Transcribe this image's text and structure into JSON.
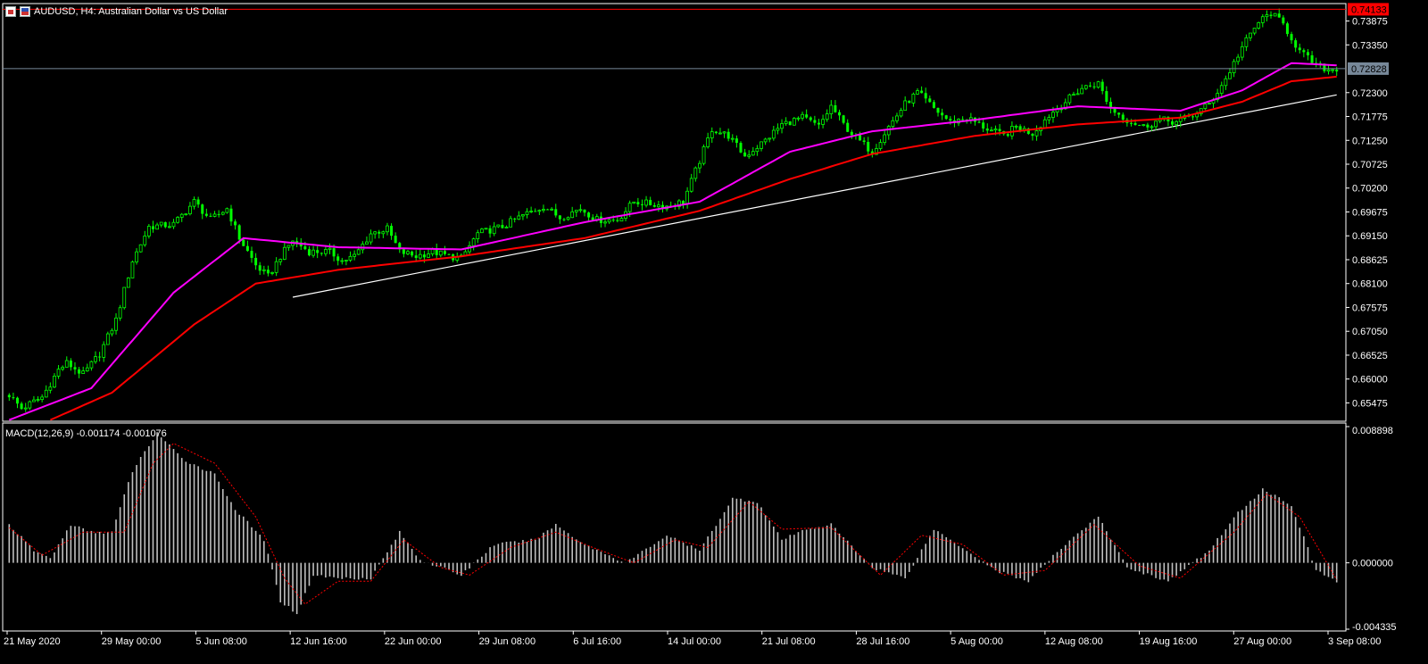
{
  "symbol_title": "AUDUSD, H4:  Australian Dollar vs US Dollar",
  "icons": [
    "chart-window-icon",
    "currency-flag-icon"
  ],
  "colors": {
    "background": "#000000",
    "bull_candle": "#00ff00",
    "ema_fast": "#ff00ff",
    "ema_slow": "#ff0000",
    "trendline": "#ffffff",
    "macd_hist": "#c0c0c0",
    "macd_signal": "#ff0000",
    "ask_line": "#ff0000",
    "bid_line": "#778899"
  },
  "price_axis": {
    "labels": [
      "0.73875",
      "0.73350",
      "0.72300",
      "0.71775",
      "0.71250",
      "0.70725",
      "0.70200",
      "0.69675",
      "0.69150",
      "0.68625",
      "0.68100",
      "0.67575",
      "0.67050",
      "0.66525",
      "0.66000",
      "0.65475"
    ],
    "ask_tag": "0.74133",
    "bid_tag": "0.72828"
  },
  "indicator": {
    "label": "MACD(12,26,9) -0.001174 -0.001076",
    "axis_labels": [
      "0.008898",
      "0.000000",
      "-0.004335"
    ]
  },
  "time_axis": [
    "21 May 2020",
    "29 May 00:00",
    "5 Jun 08:00",
    "12 Jun 16:00",
    "22 Jun 00:00",
    "29 Jun 08:00",
    "6 Jul 16:00",
    "14 Jul 00:00",
    "21 Jul 08:00",
    "28 Jul 16:00",
    "5 Aug 00:00",
    "12 Aug 08:00",
    "19 Aug 16:00",
    "27 Aug 00:00",
    "3 Sep 08:00"
  ],
  "chart_data": [
    {
      "type": "candlestick",
      "title": "AUDUSD, H4:  Australian Dollar vs US Dollar",
      "ylim": [
        0.6515,
        0.7418
      ],
      "ask": 0.74133,
      "bid": 0.72828,
      "close_keypoints": [
        {
          "t": 0,
          "v": 0.6565
        },
        {
          "t": 3,
          "v": 0.6535
        },
        {
          "t": 8,
          "v": 0.656
        },
        {
          "t": 12,
          "v": 0.662
        },
        {
          "t": 14,
          "v": 0.6635
        },
        {
          "t": 18,
          "v": 0.661
        },
        {
          "t": 22,
          "v": 0.6655
        },
        {
          "t": 26,
          "v": 0.673
        },
        {
          "t": 30,
          "v": 0.686
        },
        {
          "t": 34,
          "v": 0.6935
        },
        {
          "t": 40,
          "v": 0.694
        },
        {
          "t": 45,
          "v": 0.699
        },
        {
          "t": 49,
          "v": 0.695
        },
        {
          "t": 53,
          "v": 0.6975
        },
        {
          "t": 56,
          "v": 0.691
        },
        {
          "t": 60,
          "v": 0.685
        },
        {
          "t": 63,
          "v": 0.6825
        },
        {
          "t": 66,
          "v": 0.687
        },
        {
          "t": 69,
          "v": 0.6905
        },
        {
          "t": 73,
          "v": 0.688
        },
        {
          "t": 78,
          "v": 0.688
        },
        {
          "t": 81,
          "v": 0.686
        },
        {
          "t": 84,
          "v": 0.687
        },
        {
          "t": 88,
          "v": 0.692
        },
        {
          "t": 92,
          "v": 0.693
        },
        {
          "t": 95,
          "v": 0.688
        },
        {
          "t": 99,
          "v": 0.687
        },
        {
          "t": 103,
          "v": 0.688
        },
        {
          "t": 107,
          "v": 0.687
        },
        {
          "t": 110,
          "v": 0.6865
        },
        {
          "t": 114,
          "v": 0.692
        },
        {
          "t": 120,
          "v": 0.6935
        },
        {
          "t": 125,
          "v": 0.696
        },
        {
          "t": 130,
          "v": 0.698
        },
        {
          "t": 134,
          "v": 0.6955
        },
        {
          "t": 139,
          "v": 0.6975
        },
        {
          "t": 143,
          "v": 0.695
        },
        {
          "t": 148,
          "v": 0.695
        },
        {
          "t": 152,
          "v": 0.699
        },
        {
          "t": 156,
          "v": 0.6985
        },
        {
          "t": 160,
          "v": 0.698
        },
        {
          "t": 164,
          "v": 0.699
        },
        {
          "t": 168,
          "v": 0.708
        },
        {
          "t": 171,
          "v": 0.715
        },
        {
          "t": 175,
          "v": 0.7135
        },
        {
          "t": 179,
          "v": 0.709
        },
        {
          "t": 184,
          "v": 0.7125
        },
        {
          "t": 188,
          "v": 0.716
        },
        {
          "t": 193,
          "v": 0.7175
        },
        {
          "t": 197,
          "v": 0.7155
        },
        {
          "t": 200,
          "v": 0.72
        },
        {
          "t": 203,
          "v": 0.716
        },
        {
          "t": 206,
          "v": 0.713
        },
        {
          "t": 210,
          "v": 0.71
        },
        {
          "t": 214,
          "v": 0.7155
        },
        {
          "t": 218,
          "v": 0.7205
        },
        {
          "t": 221,
          "v": 0.723
        },
        {
          "t": 225,
          "v": 0.7195
        },
        {
          "t": 229,
          "v": 0.7165
        },
        {
          "t": 233,
          "v": 0.7175
        },
        {
          "t": 238,
          "v": 0.715
        },
        {
          "t": 242,
          "v": 0.7135
        },
        {
          "t": 245,
          "v": 0.7155
        },
        {
          "t": 249,
          "v": 0.714
        },
        {
          "t": 253,
          "v": 0.718
        },
        {
          "t": 257,
          "v": 0.721
        },
        {
          "t": 261,
          "v": 0.724
        },
        {
          "t": 265,
          "v": 0.725
        },
        {
          "t": 268,
          "v": 0.7195
        },
        {
          "t": 272,
          "v": 0.717
        },
        {
          "t": 276,
          "v": 0.7155
        },
        {
          "t": 280,
          "v": 0.717
        },
        {
          "t": 284,
          "v": 0.7165
        },
        {
          "t": 288,
          "v": 0.718
        },
        {
          "t": 292,
          "v": 0.7205
        },
        {
          "t": 296,
          "v": 0.726
        },
        {
          "t": 300,
          "v": 0.733
        },
        {
          "t": 304,
          "v": 0.7385
        },
        {
          "t": 307,
          "v": 0.7405
        },
        {
          "t": 310,
          "v": 0.738
        },
        {
          "t": 314,
          "v": 0.732
        },
        {
          "t": 318,
          "v": 0.729
        },
        {
          "t": 321,
          "v": 0.728
        },
        {
          "t": 323,
          "v": 0.7283
        }
      ],
      "ema_fast_keypoints": [
        {
          "t": 0,
          "v": 0.651
        },
        {
          "t": 20,
          "v": 0.658
        },
        {
          "t": 40,
          "v": 0.679
        },
        {
          "t": 57,
          "v": 0.691
        },
        {
          "t": 80,
          "v": 0.689
        },
        {
          "t": 110,
          "v": 0.6885
        },
        {
          "t": 140,
          "v": 0.6945
        },
        {
          "t": 168,
          "v": 0.699
        },
        {
          "t": 190,
          "v": 0.71
        },
        {
          "t": 210,
          "v": 0.7145
        },
        {
          "t": 235,
          "v": 0.717
        },
        {
          "t": 260,
          "v": 0.72
        },
        {
          "t": 285,
          "v": 0.719
        },
        {
          "t": 300,
          "v": 0.7235
        },
        {
          "t": 312,
          "v": 0.7295
        },
        {
          "t": 323,
          "v": 0.729
        }
      ],
      "ema_slow_keypoints": [
        {
          "t": 10,
          "v": 0.651
        },
        {
          "t": 25,
          "v": 0.657
        },
        {
          "t": 45,
          "v": 0.672
        },
        {
          "t": 60,
          "v": 0.681
        },
        {
          "t": 80,
          "v": 0.684
        },
        {
          "t": 110,
          "v": 0.687
        },
        {
          "t": 140,
          "v": 0.691
        },
        {
          "t": 168,
          "v": 0.697
        },
        {
          "t": 190,
          "v": 0.704
        },
        {
          "t": 210,
          "v": 0.7095
        },
        {
          "t": 235,
          "v": 0.7135
        },
        {
          "t": 260,
          "v": 0.716
        },
        {
          "t": 285,
          "v": 0.7175
        },
        {
          "t": 300,
          "v": 0.721
        },
        {
          "t": 312,
          "v": 0.7255
        },
        {
          "t": 323,
          "v": 0.7265
        }
      ],
      "trendline": {
        "from": {
          "t": 69,
          "v": 0.678
        },
        "to": {
          "t": 323,
          "v": 0.7225
        }
      }
    },
    {
      "type": "bar",
      "title": "MACD(12,26,9) -0.001174 -0.001076",
      "ylim": [
        -0.004335,
        0.008898
      ],
      "macd": -0.001174,
      "signal": -0.001076,
      "hist_keypoints": [
        {
          "t": 0,
          "v": 0.0025
        },
        {
          "t": 6,
          "v": 0.0008
        },
        {
          "t": 10,
          "v": 0.0003
        },
        {
          "t": 15,
          "v": 0.0025
        },
        {
          "t": 20,
          "v": 0.002
        },
        {
          "t": 25,
          "v": 0.002
        },
        {
          "t": 30,
          "v": 0.006
        },
        {
          "t": 36,
          "v": 0.0085
        },
        {
          "t": 42,
          "v": 0.0068
        },
        {
          "t": 50,
          "v": 0.0058
        },
        {
          "t": 55,
          "v": 0.0035
        },
        {
          "t": 62,
          "v": 0.0015
        },
        {
          "t": 66,
          "v": -0.0025
        },
        {
          "t": 70,
          "v": -0.0033
        },
        {
          "t": 74,
          "v": -0.0008
        },
        {
          "t": 80,
          "v": -0.001
        },
        {
          "t": 88,
          "v": -0.001
        },
        {
          "t": 95,
          "v": 0.002
        },
        {
          "t": 100,
          "v": 0.0002
        },
        {
          "t": 110,
          "v": -0.0008
        },
        {
          "t": 118,
          "v": 0.0012
        },
        {
          "t": 128,
          "v": 0.0015
        },
        {
          "t": 133,
          "v": 0.0025
        },
        {
          "t": 140,
          "v": 0.0012
        },
        {
          "t": 150,
          "v": 0.0
        },
        {
          "t": 160,
          "v": 0.0018
        },
        {
          "t": 168,
          "v": 0.0008
        },
        {
          "t": 176,
          "v": 0.0042
        },
        {
          "t": 182,
          "v": 0.004
        },
        {
          "t": 188,
          "v": 0.0015
        },
        {
          "t": 194,
          "v": 0.0022
        },
        {
          "t": 200,
          "v": 0.0025
        },
        {
          "t": 210,
          "v": -0.0003
        },
        {
          "t": 218,
          "v": -0.001
        },
        {
          "t": 225,
          "v": 0.0022
        },
        {
          "t": 232,
          "v": 0.001
        },
        {
          "t": 240,
          "v": -0.0005
        },
        {
          "t": 248,
          "v": -0.0012
        },
        {
          "t": 258,
          "v": 0.0015
        },
        {
          "t": 265,
          "v": 0.003
        },
        {
          "t": 272,
          "v": -0.0003
        },
        {
          "t": 282,
          "v": -0.0012
        },
        {
          "t": 292,
          "v": 0.0008
        },
        {
          "t": 298,
          "v": 0.003
        },
        {
          "t": 305,
          "v": 0.0048
        },
        {
          "t": 312,
          "v": 0.0038
        },
        {
          "t": 318,
          "v": -0.0005
        },
        {
          "t": 323,
          "v": -0.0012
        }
      ],
      "signal_keypoints": [
        {
          "t": 0,
          "v": 0.0023
        },
        {
          "t": 8,
          "v": 0.0005
        },
        {
          "t": 18,
          "v": 0.002
        },
        {
          "t": 28,
          "v": 0.002
        },
        {
          "t": 35,
          "v": 0.0065
        },
        {
          "t": 40,
          "v": 0.0078
        },
        {
          "t": 50,
          "v": 0.0065
        },
        {
          "t": 60,
          "v": 0.003
        },
        {
          "t": 67,
          "v": -0.001
        },
        {
          "t": 72,
          "v": -0.0027
        },
        {
          "t": 80,
          "v": -0.0012
        },
        {
          "t": 88,
          "v": -0.0012
        },
        {
          "t": 96,
          "v": 0.0015
        },
        {
          "t": 105,
          "v": -0.0003
        },
        {
          "t": 112,
          "v": -0.0008
        },
        {
          "t": 122,
          "v": 0.001
        },
        {
          "t": 133,
          "v": 0.002
        },
        {
          "t": 142,
          "v": 0.001
        },
        {
          "t": 152,
          "v": 0.0
        },
        {
          "t": 162,
          "v": 0.0015
        },
        {
          "t": 170,
          "v": 0.001
        },
        {
          "t": 180,
          "v": 0.004
        },
        {
          "t": 188,
          "v": 0.0022
        },
        {
          "t": 200,
          "v": 0.0023
        },
        {
          "t": 212,
          "v": -0.0008
        },
        {
          "t": 222,
          "v": 0.0018
        },
        {
          "t": 232,
          "v": 0.0012
        },
        {
          "t": 242,
          "v": -0.0008
        },
        {
          "t": 252,
          "v": -0.0005
        },
        {
          "t": 264,
          "v": 0.0025
        },
        {
          "t": 275,
          "v": -0.0002
        },
        {
          "t": 285,
          "v": -0.001
        },
        {
          "t": 298,
          "v": 0.002
        },
        {
          "t": 306,
          "v": 0.0045
        },
        {
          "t": 314,
          "v": 0.003
        },
        {
          "t": 323,
          "v": -0.0011
        }
      ]
    }
  ]
}
